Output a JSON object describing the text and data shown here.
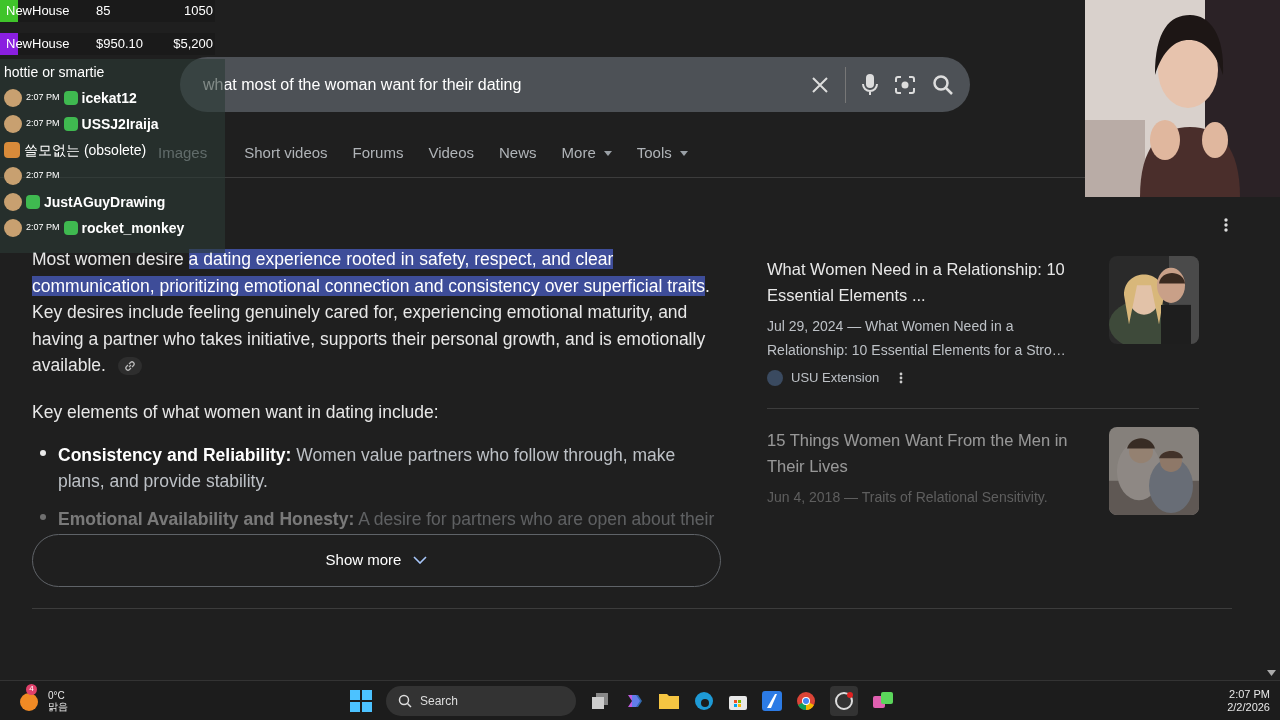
{
  "search": {
    "query": "what most of the woman want for their dating"
  },
  "tabs": [
    {
      "label": "Images",
      "selected": false
    },
    {
      "label": "Short videos",
      "selected": false
    },
    {
      "label": "Forums",
      "selected": false
    },
    {
      "label": "Videos",
      "selected": false
    },
    {
      "label": "News",
      "selected": false
    },
    {
      "label": "More",
      "selected": false,
      "dropdown": true
    },
    {
      "label": "Tools",
      "selected": false,
      "dropdown": true
    }
  ],
  "overview": {
    "prefix": "Most women desire ",
    "highlighted": "a dating experience rooted in safety, respect, and clear communication, prioritizing emotional connection and consistency over superficial traits",
    "suffix": ". Key desires include feeling genuinely cared for, experiencing emotional maturity, and having a partner who takes initiative, supports their personal growth, and is emotionally available.",
    "intro": "Key elements of what women want in dating include:",
    "bullets": [
      {
        "label": "Consistency and Reliability:",
        "text": " Women value partners who follow through, make plans, and provide stability.",
        "faded": false
      },
      {
        "label": "Emotional Availability and Honesty:",
        "text": " A desire for partners who are open about their",
        "faded": true
      }
    ],
    "show_more": "Show more"
  },
  "results": [
    {
      "title": "What Women Need in a Relationship: 10 Essential Elements ...",
      "snippet": "Jul 29, 2024 — What Women Need in a Relationship: 10 Essential Elements for a Stro…",
      "source": "USU Extension",
      "faded": false
    },
    {
      "title": "15 Things Women Want From the Men in Their Lives",
      "snippet": "Jun 4, 2018 — Traits of Relational Sensitivity.",
      "faded": true
    }
  ],
  "stream": {
    "stats": [
      {
        "label": "NewHouse",
        "value_1": "85",
        "value_2": "1050",
        "color": "#3fc42a"
      },
      {
        "label": "NewHouse",
        "value_1": "$950.10",
        "value_2": "$5,200",
        "color": "#8a1fe0"
      }
    ],
    "chat": [
      {
        "kind": "text",
        "text": "hottie or smartie"
      },
      {
        "kind": "user",
        "time": "2:07 PM",
        "user": "icekat12"
      },
      {
        "kind": "user",
        "time": "2:07 PM",
        "user": "USSJ2Iraija"
      },
      {
        "kind": "text",
        "text": "쓸모없는 (obsolete)"
      },
      {
        "kind": "user",
        "time": "2:07 PM"
      },
      {
        "kind": "user",
        "user": "JustAGuyDrawing"
      },
      {
        "kind": "user",
        "time": "2:07 PM",
        "user": "rocket_monkey"
      }
    ]
  },
  "taskbar": {
    "weather_badge": "4",
    "temperature": "0°C",
    "condition": "맑음",
    "search": "Search",
    "time": "2:07 PM",
    "date": "2/2/2026"
  }
}
